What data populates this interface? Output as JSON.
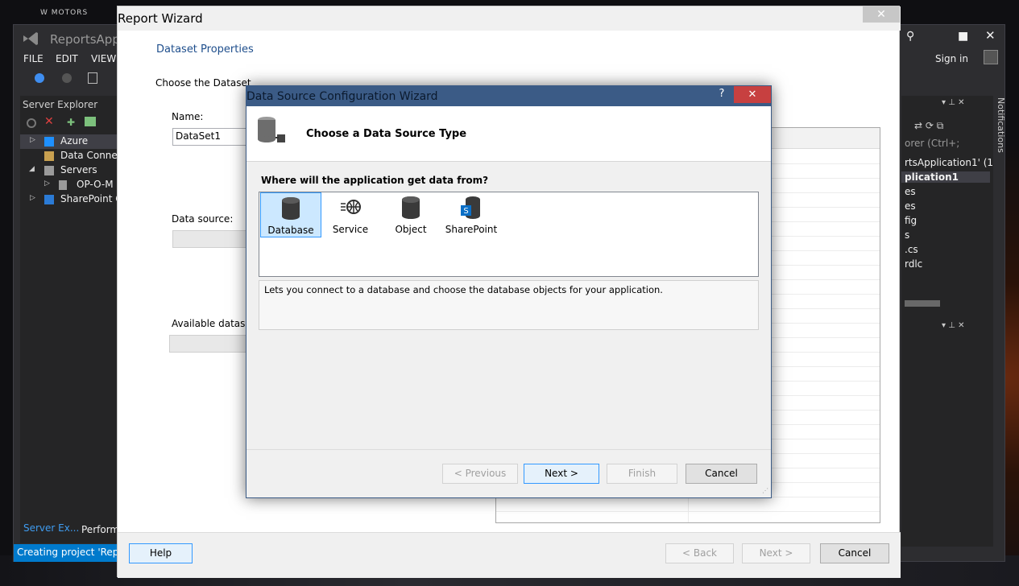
{
  "desktop": {
    "brand": "W MOTORS"
  },
  "vs": {
    "title": "ReportsApp",
    "menu": [
      "FILE",
      "EDIT",
      "VIEW"
    ],
    "server_explorer": {
      "header": "Server Explorer",
      "items": [
        {
          "label": "Azure"
        },
        {
          "label": "Data Conne"
        },
        {
          "label": "Servers"
        },
        {
          "label": "OP-O-M"
        },
        {
          "label": "SharePoint C"
        }
      ]
    },
    "bottom_tabs": [
      "Server Ex...",
      "Perform"
    ],
    "status": "Creating project 'Repor",
    "sign_in": "Sign in",
    "notifications": "Notifications",
    "solution_search": "orer (Ctrl+;",
    "solution_items": [
      "rtsApplication1' (1",
      "plication1",
      "es",
      "es",
      "fig",
      "s",
      ".cs",
      "rdlc"
    ]
  },
  "report_wizard": {
    "title": "Report Wizard",
    "heading": "Dataset Properties",
    "choose_label": "Choose the Dataset",
    "name_label": "Name:",
    "name_value": "DataSet1",
    "data_source_label": "Data source:",
    "available_label": "Available datase",
    "buttons": {
      "help": "Help",
      "back": "< Back",
      "next": "Next >",
      "cancel": "Cancel"
    }
  },
  "dsw": {
    "title": "Data Source Configuration Wizard",
    "help": "?",
    "header_title": "Choose a Data Source Type",
    "question": "Where will the application get data from?",
    "choices": [
      {
        "label": "Database",
        "icon": "database-icon",
        "selected": true
      },
      {
        "label": "Service",
        "icon": "service-icon",
        "selected": false
      },
      {
        "label": "Object",
        "icon": "object-icon",
        "selected": false
      },
      {
        "label": "SharePoint",
        "icon": "sharepoint-icon",
        "selected": false
      }
    ],
    "description": "Lets you connect to a database and choose the database objects for your application.",
    "buttons": {
      "previous": "< Previous",
      "next": "Next >",
      "finish": "Finish",
      "cancel": "Cancel"
    }
  },
  "colors": {
    "accent": "#007acc",
    "dialog_title": "#3b5b86",
    "close_red": "#c74040",
    "heading_blue": "#1e4e8c"
  }
}
